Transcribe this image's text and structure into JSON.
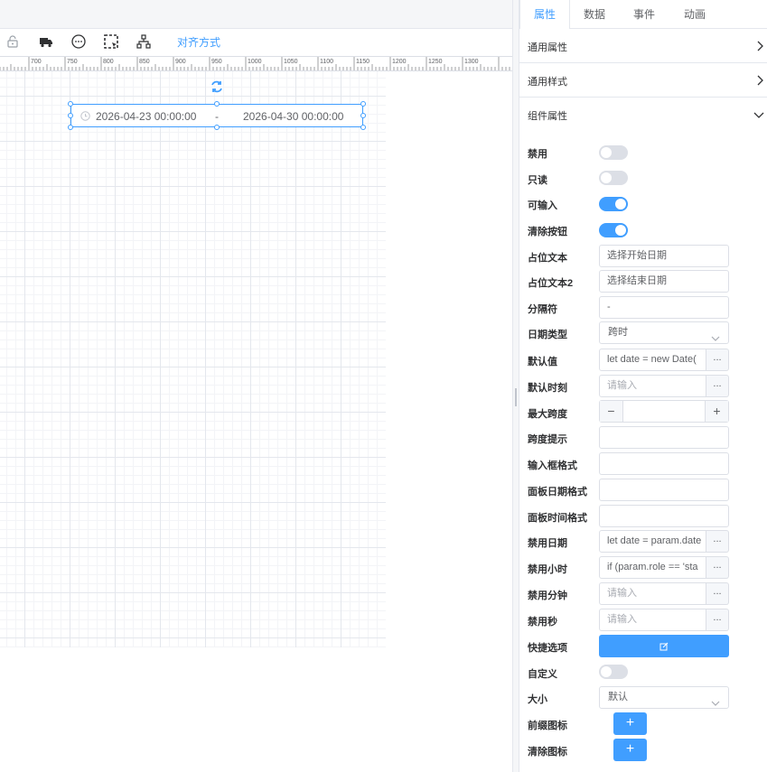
{
  "toolbar": {
    "icons": [
      "lock-icon",
      "truck-icon",
      "dots-circle-icon",
      "select-area-icon",
      "hierarchy-icon"
    ],
    "align_label": "对齐方式"
  },
  "ruler": {
    "ticks": [
      "700",
      "750",
      "800",
      "850",
      "900",
      "950",
      "1000",
      "1050",
      "1100",
      "1150",
      "1200",
      "1250",
      "1300"
    ]
  },
  "canvas": {
    "date_start": "2026-04-23 00:00:00",
    "separator": "-",
    "date_end": "2026-04-30 00:00:00"
  },
  "panel": {
    "tabs": [
      "属性",
      "数据",
      "事件",
      "动画"
    ],
    "active_tab": "属性",
    "sections": {
      "common_props": "通用属性",
      "common_style": "通用样式",
      "component_props": "组件属性"
    },
    "fields": {
      "disabled": {
        "label": "禁用",
        "on": false
      },
      "readonly": {
        "label": "只读",
        "on": false
      },
      "editable": {
        "label": "可输入",
        "on": true
      },
      "clearable": {
        "label": "清除按钮",
        "on": true
      },
      "placeholder": {
        "label": "占位文本",
        "value": "选择开始日期"
      },
      "placeholder2": {
        "label": "占位文本2",
        "value": "选择结束日期"
      },
      "separator": {
        "label": "分隔符",
        "value": "-"
      },
      "date_type": {
        "label": "日期类型",
        "value": "跨时"
      },
      "default_value": {
        "label": "默认值",
        "value": "let date = new Date("
      },
      "default_time": {
        "label": "默认时刻",
        "placeholder": "请输入"
      },
      "max_span": {
        "label": "最大跨度",
        "minus": "−",
        "plus": "+"
      },
      "span_hint": {
        "label": "跨度提示"
      },
      "input_format": {
        "label": "输入框格式"
      },
      "panel_date_format": {
        "label": "面板日期格式"
      },
      "panel_time_format": {
        "label": "面板时间格式"
      },
      "disabled_date": {
        "label": "禁用日期",
        "value": "let date = param.date"
      },
      "disabled_hours": {
        "label": "禁用小时",
        "value": "if (param.role == 'sta"
      },
      "disabled_minutes": {
        "label": "禁用分钟",
        "placeholder": "请输入"
      },
      "disabled_seconds": {
        "label": "禁用秒",
        "placeholder": "请输入"
      },
      "shortcuts": {
        "label": "快捷选项"
      },
      "custom": {
        "label": "自定义",
        "on": false
      },
      "size": {
        "label": "大小",
        "value": "默认"
      },
      "prefix_icon": {
        "label": "前缀图标",
        "button": "+"
      },
      "clear_icon": {
        "label": "清除图标",
        "button": "+"
      }
    },
    "more_button": "...",
    "accent": "#409eff"
  }
}
